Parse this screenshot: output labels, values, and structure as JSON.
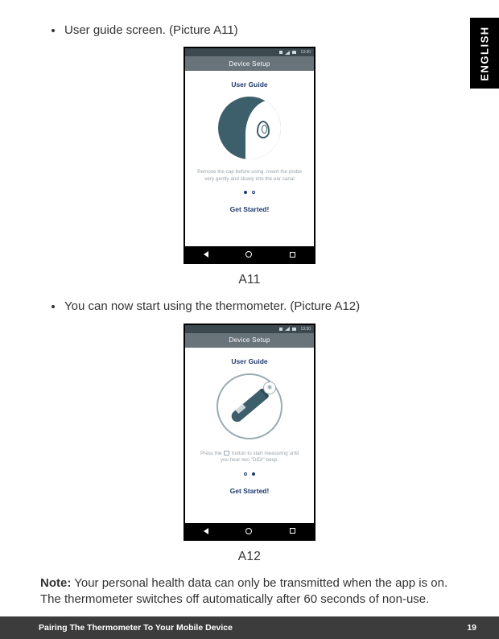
{
  "language_tab": "ENGLISH",
  "bullets": {
    "b1": "User guide screen. (Picture A11)",
    "b2": "You can now start using the thermometer. (Picture A12)"
  },
  "figures": {
    "a11": {
      "label": "A11",
      "status_time": "13:30",
      "app_bar": "Device Setup",
      "title": "User Guide",
      "instruction": "Remove the cap before using. Insert the probe very gently and slowly into the ear canal",
      "cta": "Get Started!",
      "active_dot": 0
    },
    "a12": {
      "label": "A12",
      "status_time": "13:30",
      "app_bar": "Device Setup",
      "title": "User Guide",
      "instruction_pre": "Press the ",
      "instruction_post": " button to start measuring until you hear two \"DIDI\" beep.",
      "cta": "Get Started!",
      "active_dot": 1
    }
  },
  "note": {
    "label": "Note:",
    "text": " Your personal health data can only be transmitted when the app is on. The thermometer switches off automatically after 60 seconds of non-use."
  },
  "footer": {
    "section": "Pairing The Thermometer To Your Mobile Device",
    "page": "19"
  }
}
